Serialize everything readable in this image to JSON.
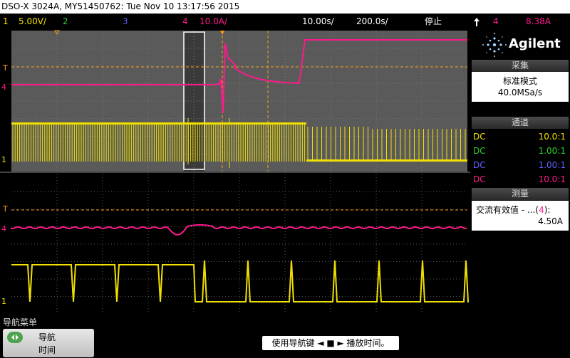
{
  "titlebar": {
    "text": "DSO-X 3024A, MY51450762: Tue Nov 10 13:17:56 2015"
  },
  "channel_bar": {
    "ch1_num": "1",
    "ch1_scale": "5.00V/",
    "ch2_num": "2",
    "ch3_num": "3",
    "ch4_num": "4",
    "ch4_scale": "10.0A/",
    "time_pos": "10.00s/",
    "time_div": "200.0s/",
    "run_state": "停止",
    "trig_icon": "trigger-edge-icon",
    "trig_source": "4",
    "trig_level": "8.38A"
  },
  "colors": {
    "ch1": "#f0e000",
    "ch2": "#30d030",
    "ch3": "#6060ff",
    "ch4": "#ff1a8c",
    "trigger": "#ff9d1a"
  },
  "right_panel": {
    "logo_text": "Agilent",
    "acquire_header": "采集",
    "acquire_mode": "标准模式",
    "sample_rate": "40.0MSa/s",
    "channels_header": "通道",
    "channels": [
      {
        "coupling": "DC",
        "ratio": "10.0:1",
        "color": "#f0e000"
      },
      {
        "coupling": "DC",
        "ratio": "1.00:1",
        "color": "#30d030"
      },
      {
        "coupling": "DC",
        "ratio": "1.00:1",
        "color": "#6060ff"
      },
      {
        "coupling": "DC",
        "ratio": "10.0:1",
        "color": "#ff1a8c"
      }
    ],
    "measure_header": "测量",
    "measure_label": "交流有效值 - ...(",
    "measure_src": "4",
    "measure_close": "):",
    "measure_value": "4.50A"
  },
  "bottom": {
    "menu_title": "导航菜单",
    "nav_line1": "导航",
    "nav_line2": "时间",
    "hint": "使用导航键 ◄ ■ ► 播放时间。"
  },
  "markers": {
    "ch1": "1",
    "ch4": "4",
    "trigger": "T"
  }
}
